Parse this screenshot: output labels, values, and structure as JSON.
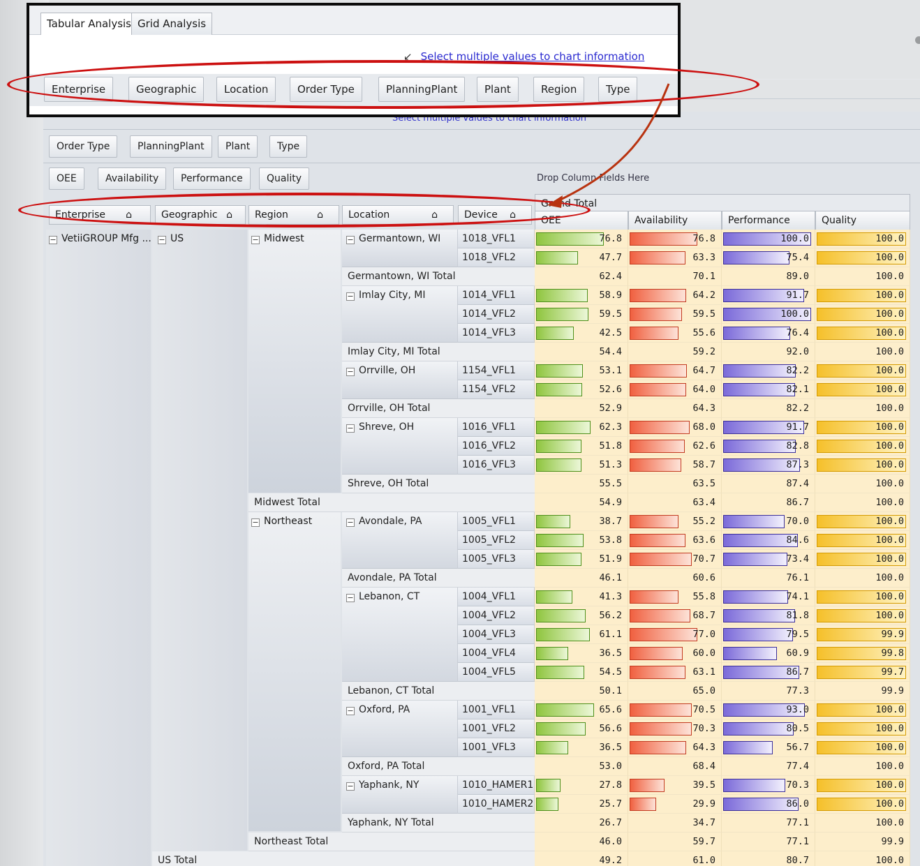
{
  "top_window": {
    "tabs": [
      "Tabular Analysis",
      "Grid Analysis"
    ],
    "hint": "Select multiple values to chart information",
    "field_buttons": [
      "Enterprise",
      "Geographic",
      "Location",
      "Order Type",
      "PlanningPlant",
      "Plant",
      "Region",
      "Type"
    ]
  },
  "app": {
    "hint_background": "Select multiple values to chart information",
    "filter_buttons": [
      "Order Type",
      "PlanningPlant",
      "Plant",
      "Type"
    ],
    "data_buttons": [
      "OEE",
      "Availability",
      "Performance",
      "Quality"
    ],
    "drop_column_label": "Drop Column Fields Here",
    "grand_total_label": "Grand Total",
    "row_headers": [
      "Enterprise",
      "Geographic",
      "Region",
      "Location",
      "Device"
    ],
    "measure_headers": [
      "OEE",
      "Availability",
      "Performance",
      "Quality"
    ],
    "enterprise": "VetiiGROUP Mfg ...",
    "geographic": "US",
    "regions": [
      "Midwest",
      "Northeast"
    ],
    "rows": [
      {
        "loc": "Germantown, WI",
        "dev": "1018_VFL1",
        "oee": "76.8",
        "av": "76.8",
        "pe": "100.0",
        "qu": "100.0"
      },
      {
        "dev": "1018_VFL2",
        "oee": "47.7",
        "av": "63.3",
        "pe": "75.4",
        "qu": "100.0"
      },
      {
        "total": "Germantown, WI Total",
        "oee": "62.4",
        "av": "70.1",
        "pe": "89.0",
        "qu": "100.0"
      },
      {
        "loc": "Imlay City, MI",
        "dev": "1014_VFL1",
        "oee": "58.9",
        "av": "64.2",
        "pe": "91.7",
        "qu": "100.0"
      },
      {
        "dev": "1014_VFL2",
        "oee": "59.5",
        "av": "59.5",
        "pe": "100.0",
        "qu": "100.0"
      },
      {
        "dev": "1014_VFL3",
        "oee": "42.5",
        "av": "55.6",
        "pe": "76.4",
        "qu": "100.0"
      },
      {
        "total": "Imlay City, MI Total",
        "oee": "54.4",
        "av": "59.2",
        "pe": "92.0",
        "qu": "100.0"
      },
      {
        "loc": "Orrville, OH",
        "dev": "1154_VFL1",
        "oee": "53.1",
        "av": "64.7",
        "pe": "82.2",
        "qu": "100.0"
      },
      {
        "dev": "1154_VFL2",
        "oee": "52.6",
        "av": "64.0",
        "pe": "82.1",
        "qu": "100.0"
      },
      {
        "total": "Orrville, OH Total",
        "oee": "52.9",
        "av": "64.3",
        "pe": "82.2",
        "qu": "100.0"
      },
      {
        "loc": "Shreve, OH",
        "dev": "1016_VFL1",
        "oee": "62.3",
        "av": "68.0",
        "pe": "91.7",
        "qu": "100.0"
      },
      {
        "dev": "1016_VFL2",
        "oee": "51.8",
        "av": "62.6",
        "pe": "82.8",
        "qu": "100.0"
      },
      {
        "dev": "1016_VFL3",
        "oee": "51.3",
        "av": "58.7",
        "pe": "87.3",
        "qu": "100.0"
      },
      {
        "total": "Shreve, OH Total",
        "oee": "55.5",
        "av": "63.5",
        "pe": "87.4",
        "qu": "100.0"
      },
      {
        "rtotal": "Midwest Total",
        "oee": "54.9",
        "av": "63.4",
        "pe": "86.7",
        "qu": "100.0"
      },
      {
        "loc": "Avondale, PA",
        "dev": "1005_VFL1",
        "oee": "38.7",
        "av": "55.2",
        "pe": "70.0",
        "qu": "100.0"
      },
      {
        "dev": "1005_VFL2",
        "oee": "53.8",
        "av": "63.6",
        "pe": "84.6",
        "qu": "100.0"
      },
      {
        "dev": "1005_VFL3",
        "oee": "51.9",
        "av": "70.7",
        "pe": "73.4",
        "qu": "100.0"
      },
      {
        "total": "Avondale, PA Total",
        "oee": "46.1",
        "av": "60.6",
        "pe": "76.1",
        "qu": "100.0"
      },
      {
        "loc": "Lebanon, CT",
        "dev": "1004_VFL1",
        "oee": "41.3",
        "av": "55.8",
        "pe": "74.1",
        "qu": "100.0"
      },
      {
        "dev": "1004_VFL2",
        "oee": "56.2",
        "av": "68.7",
        "pe": "81.8",
        "qu": "100.0"
      },
      {
        "dev": "1004_VFL3",
        "oee": "61.1",
        "av": "77.0",
        "pe": "79.5",
        "qu": "99.9"
      },
      {
        "dev": "1004_VFL4",
        "oee": "36.5",
        "av": "60.0",
        "pe": "60.9",
        "qu": "99.8"
      },
      {
        "dev": "1004_VFL5",
        "oee": "54.5",
        "av": "63.1",
        "pe": "86.7",
        "qu": "99.7"
      },
      {
        "total": "Lebanon, CT Total",
        "oee": "50.1",
        "av": "65.0",
        "pe": "77.3",
        "qu": "99.9"
      },
      {
        "loc": "Oxford, PA",
        "dev": "1001_VFL1",
        "oee": "65.6",
        "av": "70.5",
        "pe": "93.0",
        "qu": "100.0"
      },
      {
        "dev": "1001_VFL2",
        "oee": "56.6",
        "av": "70.3",
        "pe": "80.5",
        "qu": "100.0"
      },
      {
        "dev": "1001_VFL3",
        "oee": "36.5",
        "av": "64.3",
        "pe": "56.7",
        "qu": "100.0"
      },
      {
        "total": "Oxford, PA Total",
        "oee": "53.0",
        "av": "68.4",
        "pe": "77.4",
        "qu": "100.0"
      },
      {
        "loc": "Yaphank, NY",
        "dev": "1010_HAMER1",
        "oee": "27.8",
        "av": "39.5",
        "pe": "70.3",
        "qu": "100.0"
      },
      {
        "dev": "1010_HAMER2",
        "oee": "25.7",
        "av": "29.9",
        "pe": "86.0",
        "qu": "100.0"
      },
      {
        "total": "Yaphank, NY Total",
        "oee": "26.7",
        "av": "34.7",
        "pe": "77.1",
        "qu": "100.0"
      },
      {
        "rtotal": "Northeast Total",
        "oee": "46.0",
        "av": "59.7",
        "pe": "77.1",
        "qu": "99.9"
      },
      {
        "gtotal": "US Total",
        "oee": "49.2",
        "av": "61.0",
        "pe": "80.7",
        "qu": "100.0"
      }
    ]
  },
  "colors": {
    "oee": "#8fc53f",
    "availability": "#f06040",
    "performance": "#7b6ad9",
    "quality": "#f5c02a",
    "annotation": "#cc1010",
    "arrow": "#b83310"
  }
}
